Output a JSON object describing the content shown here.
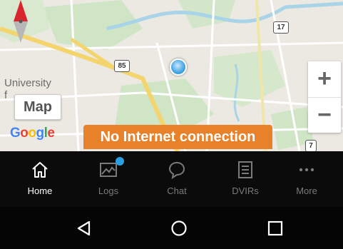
{
  "map": {
    "place_label_line1": "University",
    "place_label_line2": "f",
    "map_button": "Map",
    "google_logo": [
      "G",
      "o",
      "o",
      "g",
      "l",
      "e"
    ],
    "zoom_in": "+",
    "zoom_out": "−",
    "route_85": "85",
    "route_17": "17",
    "route_7": "7"
  },
  "toast": {
    "message": "No Internet connection"
  },
  "nav": {
    "items": [
      {
        "label": "Home",
        "icon": "home-icon",
        "active": true
      },
      {
        "label": "Logs",
        "icon": "logs-icon",
        "badge": true
      },
      {
        "label": "Chat",
        "icon": "chat-icon"
      },
      {
        "label": "DVIRs",
        "icon": "dvir-icon"
      },
      {
        "label": "More",
        "icon": "more-icon"
      }
    ]
  },
  "system_nav": [
    "back-icon",
    "home-circle-icon",
    "recents-icon"
  ],
  "colors": {
    "toast": "#e8822a",
    "badge": "#2aa0e0",
    "nav_bg": "#0b0b0b",
    "active": "#ffffff",
    "inactive": "#7a7a7a"
  }
}
